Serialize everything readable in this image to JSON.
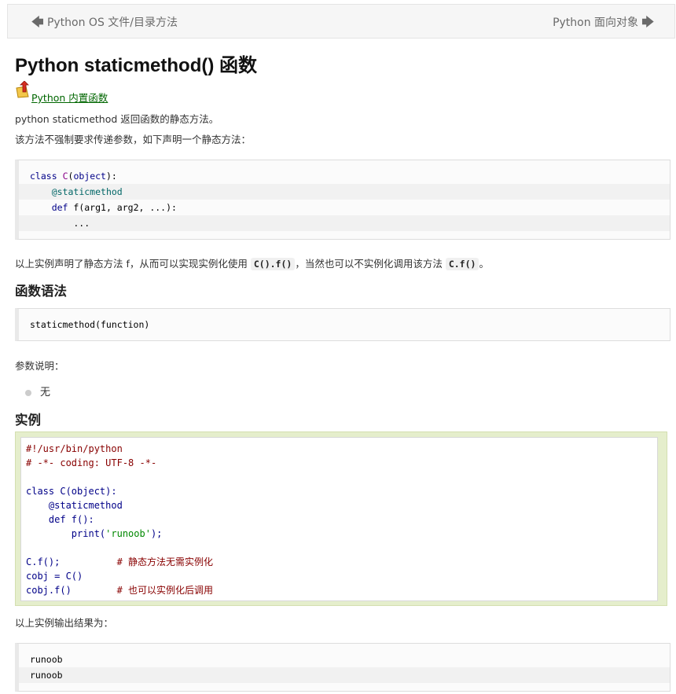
{
  "nav": {
    "prev_arrow": "🡄",
    "prev_label": "Python OS 文件/目录方法",
    "next_label": "Python 面向对象",
    "next_arrow": "🡆"
  },
  "title": "Python staticmethod() 函数",
  "builtin_link": {
    "icon": "up-arrow-folder-icon",
    "label": "Python 内置函数"
  },
  "intro": [
    "python staticmethod 返回函数的静态方法。",
    "该方法不强制要求传递参数，如下声明一个静态方法："
  ],
  "decl_code": [
    "class C(object):",
    "    @staticmethod",
    "    def f(arg1, arg2, ...):",
    "        ..."
  ],
  "after_decl": {
    "before": "以上实例声明了静态方法 f，从而可以实现实例化使用 ",
    "code1": "C().f()",
    "middle": "，当然也可以不实例化调用该方法 ",
    "code2": "C.f()",
    "after": "。"
  },
  "syntax_heading": "函数语法",
  "syntax_code": "staticmethod(function)",
  "params_label": "参数说明：",
  "params_items": [
    "无"
  ],
  "example_heading": "实例",
  "example_code": [
    "#!/usr/bin/python",
    "# -*- coding: UTF-8 -*-",
    "",
    "class C(object):",
    "    @staticmethod",
    "    def f():",
    "        print('runoob');",
    "",
    "C.f();          # 静态方法无需实例化",
    "cobj = C()",
    "cobj.f()        # 也可以实例化后调用"
  ],
  "output_label": "以上实例输出结果为：",
  "output_lines": [
    "runoob",
    "runoob"
  ],
  "colors": {
    "link": "#006600",
    "example_bg": "#e5eecc",
    "code_bg": "#fbfbfb"
  }
}
